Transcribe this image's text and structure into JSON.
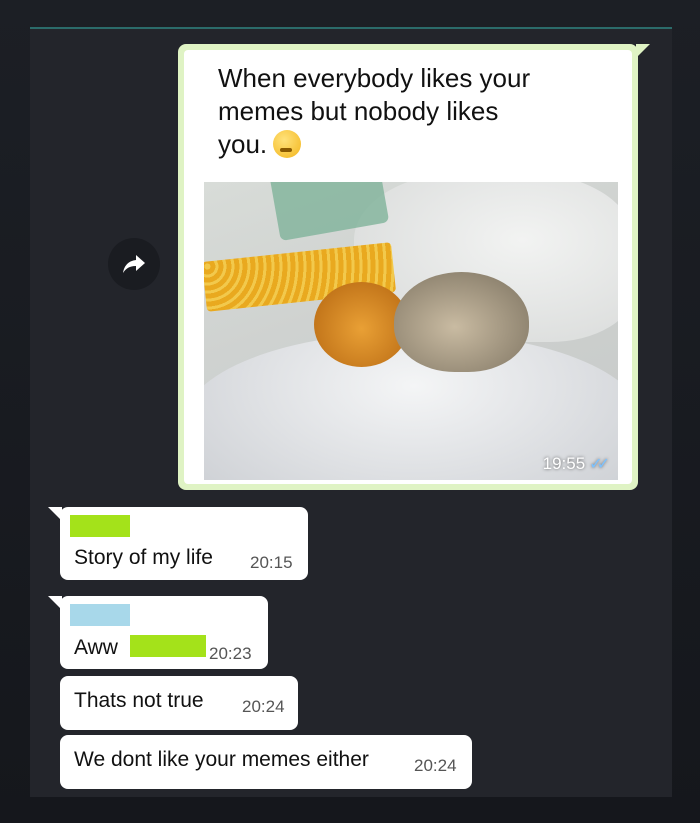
{
  "forwarded_message": {
    "caption": "When everybody likes your memes but nobody likes you.",
    "time": "19:55",
    "read_receipt_icon": "double-check-icon",
    "forward_icon": "forward-arrow-icon"
  },
  "messages": [
    {
      "text": "Story of my life",
      "time": "20:15"
    },
    {
      "text": "Aww",
      "time": "20:23"
    },
    {
      "text": "Thats not true",
      "time": "20:24"
    },
    {
      "text": "We dont like your memes either",
      "time": "20:24"
    }
  ],
  "colors": {
    "outgoing_bubble": "#dff3c4",
    "incoming_bubble": "#ffffff",
    "chat_background": "#23252b",
    "redaction_green": "#a4e21a",
    "redaction_blue": "#a8d8ea",
    "read_tick": "#7cc2ff"
  }
}
